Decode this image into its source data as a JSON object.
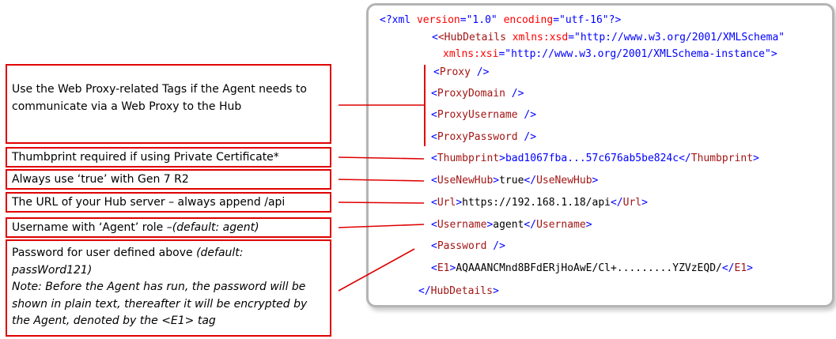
{
  "callouts": {
    "proxy": {
      "text": "Use the Web Proxy-related Tags if the Agent needs to communicate via a Web Proxy to the Hub"
    },
    "thumbprint": {
      "text": "Thumbprint required if using Private Certificate*"
    },
    "usenewhub": {
      "text": "Always use ‘true’ with Gen 7 R2"
    },
    "url": {
      "text": "The URL of your Hub server – always append /api"
    },
    "username": {
      "text": "Username with ‘Agent’ role – ",
      "italic": "(default: agent)"
    },
    "password": {
      "text": "Password for user defined above ",
      "italic_default": "(default: passWord121)",
      "note": "Note: Before the Agent has run, the password will be shown in plain text, thereafter it will be encrypted by the Agent, denoted by the <E1> tag"
    }
  },
  "xml": {
    "decl_open": "<?xml ",
    "decl_version_attr": "version",
    "decl_version_val": "\"1.0\"",
    "decl_encoding_attr": "encoding",
    "decl_encoding_val": "\"utf-16\"",
    "decl_close": "?>",
    "hub_open": "<HubDetails ",
    "xsd_attr": "xmlns:xsd",
    "xsd_val": "\"http://www.w3.org/2001/XMLSchema\"",
    "xsi_attr": "xmlns:xsi",
    "xsi_val": "\"http://www.w3.org/2001/XMLSchema-instance\"",
    "proxy_tag": "Proxy",
    "proxy_domain_tag": "ProxyDomain",
    "proxy_username_tag": "ProxyUsername",
    "proxy_password_tag": "ProxyPassword",
    "thumbprint_tag": "Thumbprint",
    "thumbprint_value": "bad1067fba...57c676ab5be824c",
    "usenewhub_tag": "UseNewHub",
    "usenewhub_value": "true",
    "url_tag": "Url",
    "url_value": "https://192.168.1.18/api",
    "username_tag": "Username",
    "username_value": "agent",
    "password_tag": "Password",
    "e1_tag": "E1",
    "e1_value": "AQAAANCMnd8BFdERjHoAwE/Cl+.........YZVzEQD/",
    "hub_close_tag": "HubDetails"
  },
  "colors": {
    "callout_border": "#e00000",
    "connector": "#e00000",
    "xml_tag": "#0000ff",
    "xml_element_name": "#a31515",
    "xml_attr_name": "#ff0000",
    "xml_text": "#000000",
    "panel_border": "#b4b4b4"
  }
}
